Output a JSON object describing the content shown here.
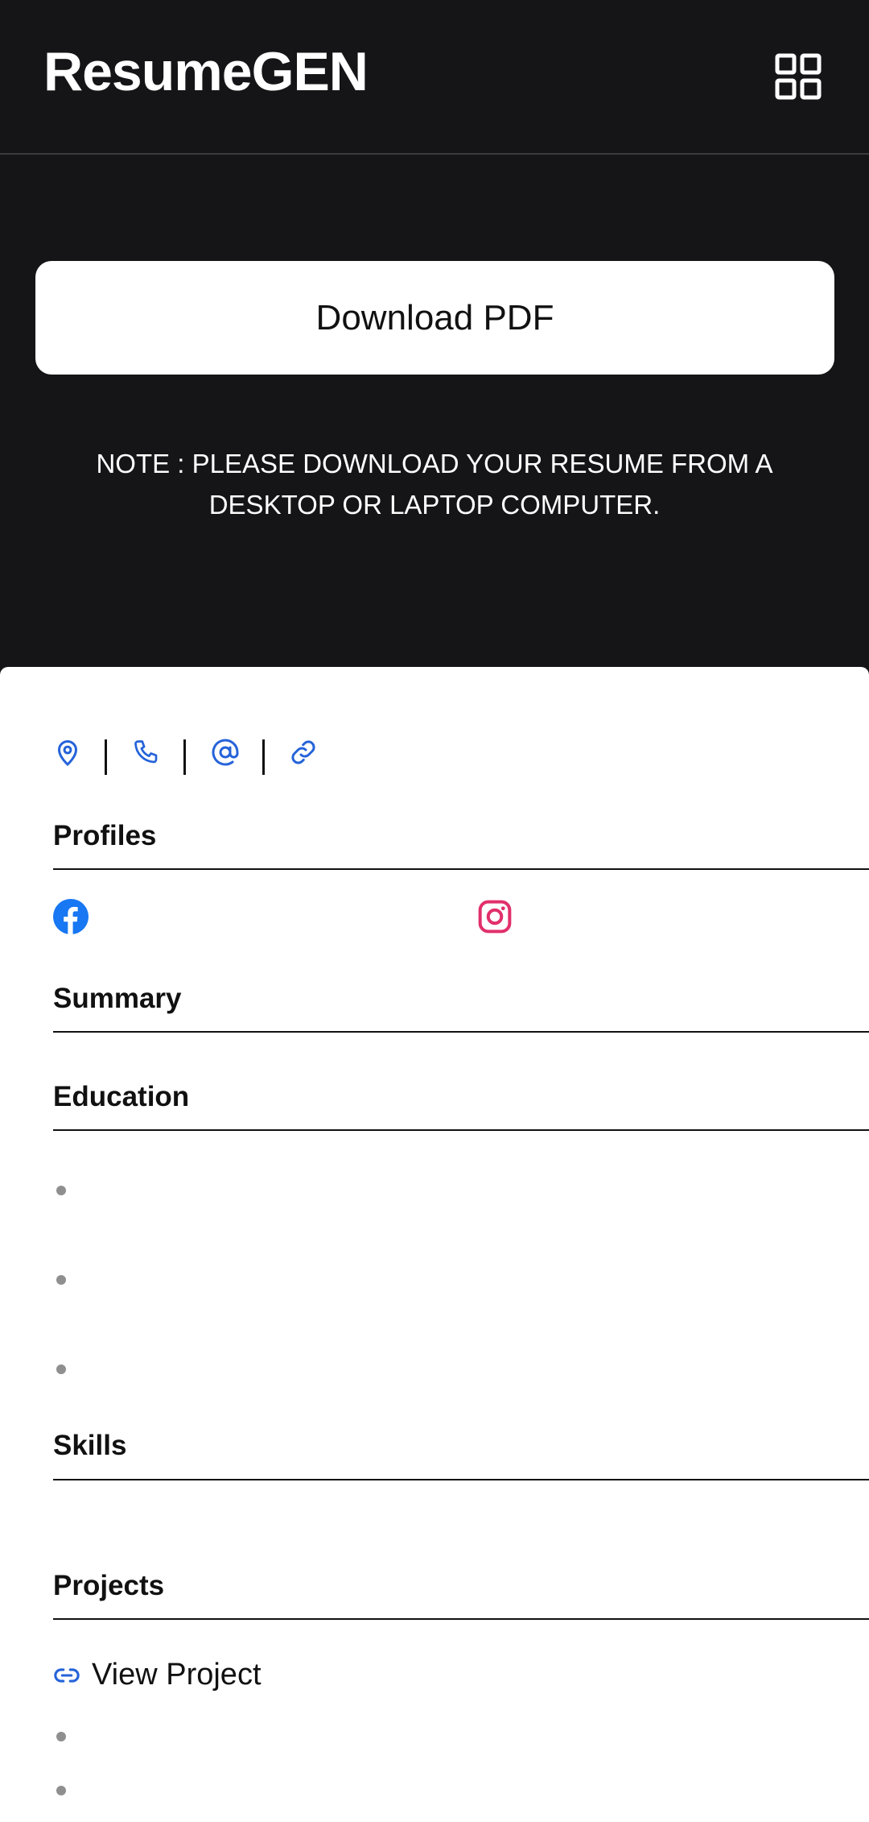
{
  "app": {
    "title": "ResumeGEN"
  },
  "header": {
    "menu_icon": "grid-icon"
  },
  "actions": {
    "download_label": "Download PDF"
  },
  "note": "NOTE : PLEASE DOWNLOAD YOUR RESUME FROM A DESKTOP OR LAPTOP COMPUTER.",
  "contact": {
    "icons": [
      "location-pin-icon",
      "phone-icon",
      "at-sign-icon",
      "link-icon"
    ],
    "accent": "#2563d9"
  },
  "sections": {
    "profiles": "Profiles",
    "summary": "Summary",
    "education": "Education",
    "skills": "Skills",
    "projects": "Projects"
  },
  "profiles": [
    {
      "icon": "facebook-icon",
      "color": "#1877f2"
    },
    {
      "icon": "instagram-icon",
      "color": "#e1306c"
    }
  ],
  "projects": {
    "link_label": "View Project",
    "link_icon": "link-icon"
  }
}
